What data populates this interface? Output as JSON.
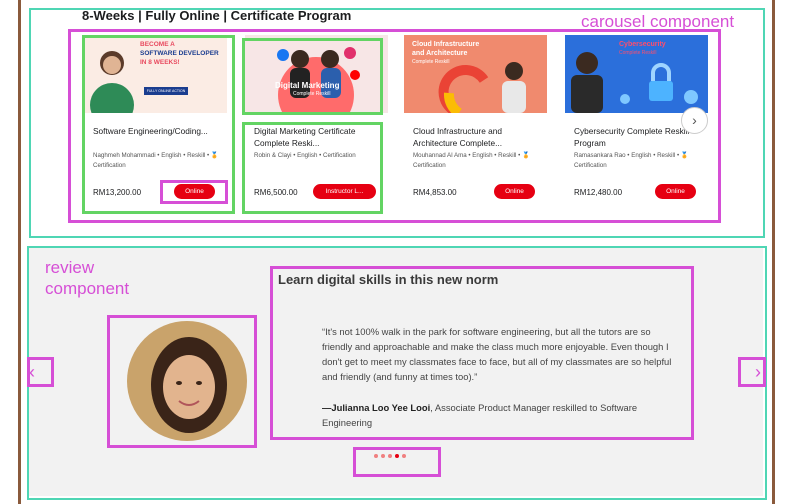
{
  "section": {
    "title": "8-Weeks | Fully Online | Certificate Program"
  },
  "annotations": {
    "carousel": "carousel component",
    "review_line1": "review",
    "review_line2": "component"
  },
  "cards": [
    {
      "thumb_line1": "BECOME A",
      "thumb_line2": "SOFTWARE DEVELOPER",
      "thumb_line3": "IN 8 WEEKS!",
      "thumb_btn": "FULLY ONLINE ACTION",
      "title": "Software Engineering/Coding...",
      "meta": "Naghmeh Mohammadi • English • Reskill • 🏅Certification",
      "price": "RM13,200.00",
      "button": "Online"
    },
    {
      "thumb_line1": "Digital Marketing",
      "thumb_line2": "Complete Reskill",
      "title": "Digital Marketing Certificate Complete Reski...",
      "meta": "Robin & Clayi • English • Certification",
      "price": "RM6,500.00",
      "button": "Instructor L..."
    },
    {
      "thumb_line1": "Cloud Infrastructure",
      "thumb_line2": "and Architecture",
      "thumb_line3": "Complete Reskill",
      "title": "Cloud Infrastructure and Architecture Complete...",
      "meta": "Mouhannad Al Ama • English • Reskill • 🏅Certification",
      "price": "RM4,853.00",
      "button": "Online"
    },
    {
      "thumb_line1": "Cybersecurity",
      "thumb_line2": "Complete Reskill",
      "title": "Cybersecurity Complete Reskill Program",
      "meta": "Ramasankara Rao • English • Reskill • 🏅Certification",
      "price": "RM12,480.00",
      "button": "Online"
    }
  ],
  "review": {
    "title": "Learn digital skills in this new norm",
    "quote": "“It's not 100% walk in the park for software engineering, but all the tutors are so friendly and approachable and make the class much more enjoyable. Even though I don't get to meet my classmates face to face, but all of my classmates are so helpful and friendly (and funny at times too).”",
    "author_name": "—Julianna Loo Yee Looi",
    "author_role": ", Associate Product Manager reskilled to Software Engineering",
    "dots": [
      false,
      false,
      false,
      true,
      false
    ]
  },
  "icons": {
    "next": "chevron-right-icon",
    "prev": "chevron-left-icon"
  }
}
